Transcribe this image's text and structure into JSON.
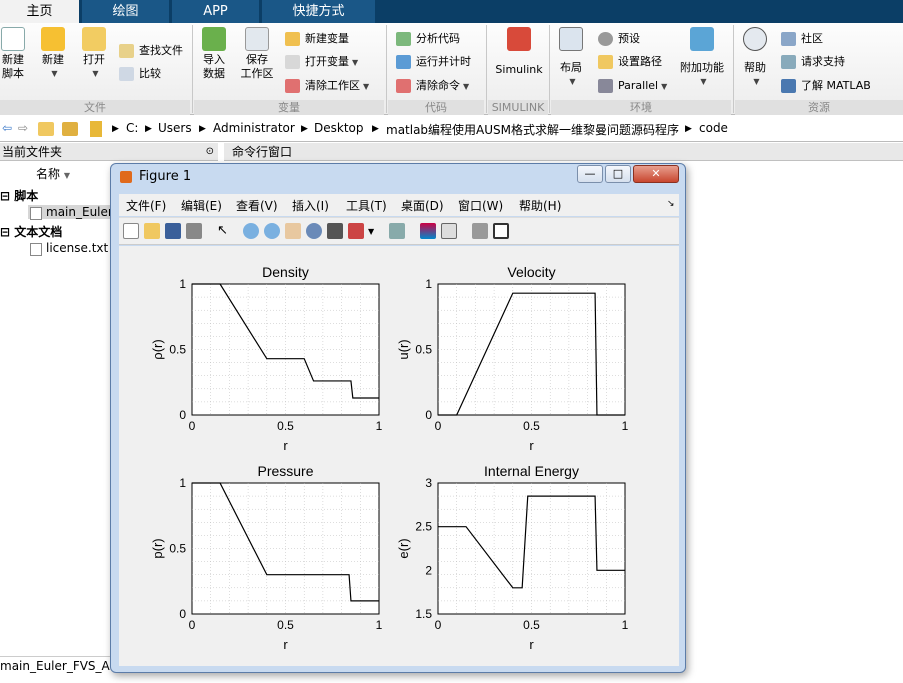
{
  "tabs": [
    "主页",
    "绘图",
    "APP",
    "快捷方式"
  ],
  "ribbon": {
    "file": {
      "new_script": "新建\n脚本",
      "new": "新建",
      "open": "打开",
      "find_files": "查找文件",
      "compare": "比较",
      "footer": "文件"
    },
    "variable": {
      "import": "导入\n数据",
      "save_ws": "保存\n工作区",
      "new_var": "新建变量",
      "open_var": "打开变量",
      "clear_ws": "清除工作区",
      "footer": "变量"
    },
    "code": {
      "analyze": "分析代码",
      "run_time": "运行并计时",
      "clear_cmd": "清除命令",
      "footer": "代码"
    },
    "simulink": {
      "label": "Simulink",
      "footer": "SIMULINK"
    },
    "env": {
      "layout": "布局",
      "prefs": "预设",
      "set_path": "设置路径",
      "parallel": "Parallel",
      "addons": "附加功能",
      "footer": "环境"
    },
    "res": {
      "help": "帮助",
      "community": "社区",
      "support": "请求支持",
      "learn": "了解 MATLAB",
      "footer": "资源"
    }
  },
  "address": [
    "C:",
    "Users",
    "Administrator",
    "Desktop",
    "matlab编程使用AUSM格式求解一维黎曼问题源码程序",
    "code"
  ],
  "panels": {
    "current_folder": "当前文件夹",
    "command_window": "命令行窗口",
    "name_col": "名称"
  },
  "files": {
    "scripts_group": "脚本",
    "script_file": "main_Euler",
    "text_group": "文本文档",
    "text_file": "license.txt",
    "bottom_file": "main_Euler_FVS_AUS"
  },
  "figure": {
    "title": "Figure 1",
    "menu": [
      "文件(F)",
      "编辑(E)",
      "查看(V)",
      "插入(I)",
      "工具(T)",
      "桌面(D)",
      "窗口(W)",
      "帮助(H)"
    ],
    "minimize": "—",
    "restore": "□",
    "close": "✕"
  },
  "chart_data": [
    {
      "type": "line",
      "title": "Density",
      "xlabel": "r",
      "ylabel": "ρ(r)",
      "xlim": [
        0,
        1
      ],
      "ylim": [
        0,
        1
      ],
      "xticks": [
        "0",
        "0.5",
        "1"
      ],
      "yticks": [
        "0",
        "0.5",
        "1"
      ],
      "grid": true,
      "series": [
        {
          "x": [
            0,
            0.15,
            0.4,
            0.45,
            0.6,
            0.65,
            0.85,
            0.86,
            1
          ],
          "values": [
            1,
            1,
            0.43,
            0.43,
            0.43,
            0.26,
            0.26,
            0.13,
            0.13
          ]
        }
      ]
    },
    {
      "type": "line",
      "title": "Velocity",
      "xlabel": "r",
      "ylabel": "u(r)",
      "xlim": [
        0,
        1
      ],
      "ylim": [
        0,
        1
      ],
      "xticks": [
        "0",
        "0.5",
        "1"
      ],
      "yticks": [
        "0",
        "0.5",
        "1"
      ],
      "grid": true,
      "series": [
        {
          "x": [
            0,
            0.1,
            0.4,
            0.45,
            0.84,
            0.85,
            1
          ],
          "values": [
            0,
            0,
            0.93,
            0.93,
            0.93,
            0,
            0
          ]
        }
      ]
    },
    {
      "type": "line",
      "title": "Pressure",
      "xlabel": "r",
      "ylabel": "p(r)",
      "xlim": [
        0,
        1
      ],
      "ylim": [
        0,
        1
      ],
      "xticks": [
        "0",
        "0.5",
        "1"
      ],
      "yticks": [
        "0",
        "0.5",
        "1"
      ],
      "grid": true,
      "series": [
        {
          "x": [
            0,
            0.15,
            0.4,
            0.45,
            0.84,
            0.85,
            1
          ],
          "values": [
            1,
            1,
            0.3,
            0.3,
            0.3,
            0.1,
            0.1
          ]
        }
      ]
    },
    {
      "type": "line",
      "title": "Internal Energy",
      "xlabel": "r",
      "ylabel": "e(r)",
      "xlim": [
        0,
        1
      ],
      "ylim": [
        1.5,
        3
      ],
      "xticks": [
        "0",
        "0.5",
        "1"
      ],
      "yticks": [
        "1.5",
        "2",
        "2.5",
        "3"
      ],
      "grid": true,
      "series": [
        {
          "x": [
            0,
            0.15,
            0.4,
            0.45,
            0.48,
            0.84,
            0.85,
            1
          ],
          "values": [
            2.5,
            2.5,
            1.8,
            1.8,
            2.85,
            2.85,
            2.0,
            2.0
          ]
        }
      ]
    }
  ]
}
